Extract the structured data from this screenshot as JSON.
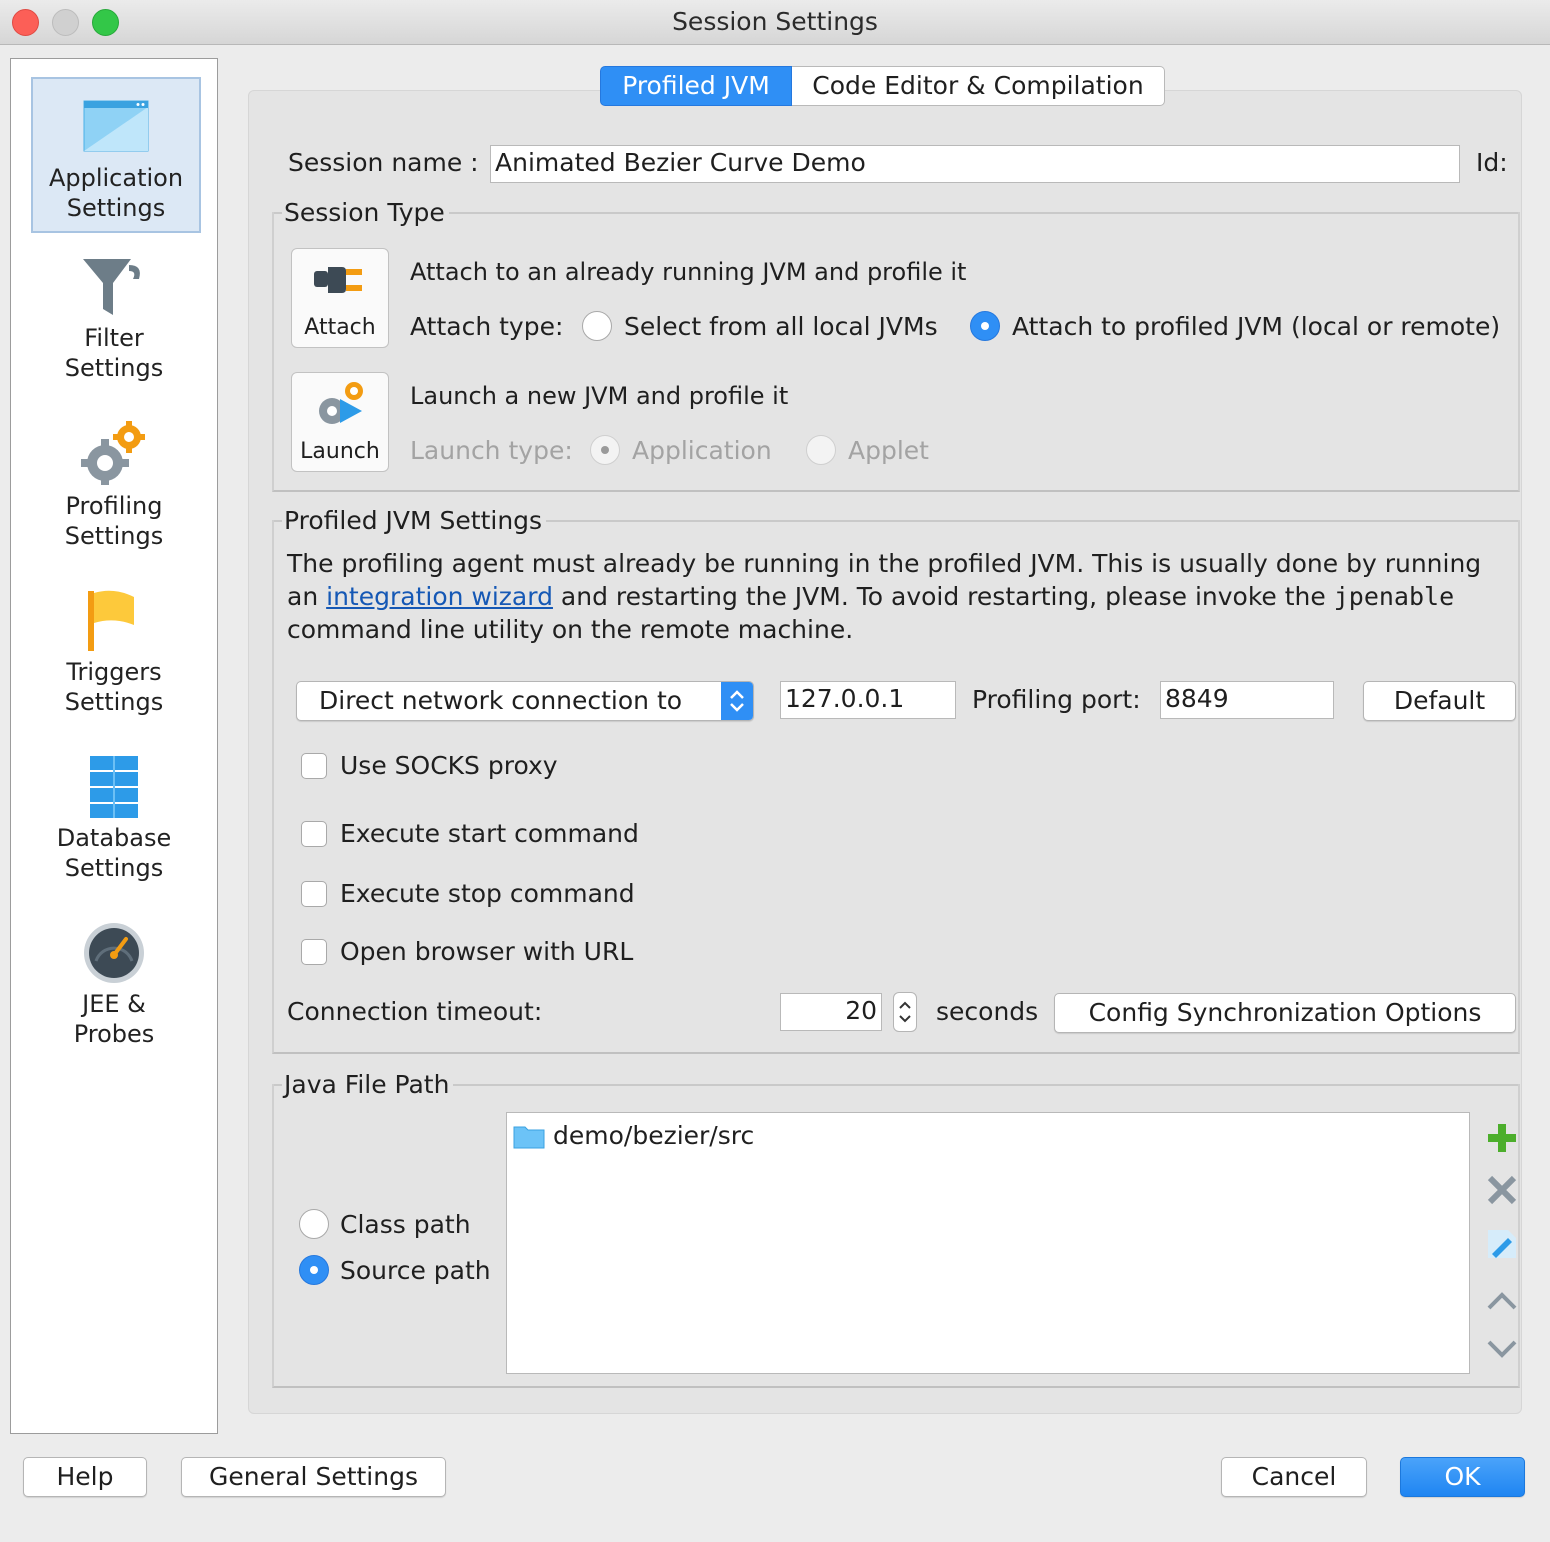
{
  "window": {
    "title": "Session Settings"
  },
  "sidebar": {
    "items": [
      {
        "line1": "Application",
        "line2": "Settings",
        "icon": "application-window-icon",
        "selected": true
      },
      {
        "line1": "Filter",
        "line2": "Settings",
        "icon": "funnel-icon"
      },
      {
        "line1": "Profiling",
        "line2": "Settings",
        "icon": "gears-icon"
      },
      {
        "line1": "Triggers",
        "line2": "Settings",
        "icon": "flag-icon"
      },
      {
        "line1": "Database",
        "line2": "Settings",
        "icon": "database-icon"
      },
      {
        "line1": "JEE &",
        "line2": "Probes",
        "icon": "gauge-icon"
      }
    ]
  },
  "tabs": [
    {
      "label": "Profiled JVM",
      "active": true
    },
    {
      "label": "Code Editor & Compilation",
      "active": false
    }
  ],
  "session": {
    "name_label": "Session name :",
    "name_value": "Animated Bezier Curve Demo",
    "id_label": "Id:"
  },
  "session_type": {
    "title": "Session Type",
    "attach": {
      "button_label": "Attach",
      "description": "Attach to an already running JVM and profile it",
      "type_label": "Attach type:",
      "options": [
        {
          "label": "Select from all local JVMs",
          "selected": false
        },
        {
          "label": "Attach to profiled JVM (local or remote)",
          "selected": true
        }
      ]
    },
    "launch": {
      "button_label": "Launch",
      "description": "Launch a new JVM and profile it",
      "type_label": "Launch type:",
      "options": [
        {
          "label": "Application",
          "selected": true
        },
        {
          "label": "Applet",
          "selected": false
        }
      ]
    }
  },
  "profiled_jvm": {
    "title": "Profiled JVM Settings",
    "info_before_link": "The profiling agent must already be running in the profiled JVM. This is usually done by running",
    "info_an": "an",
    "link_text": "integration wizard",
    "info_after_link": "and restarting the JVM. To avoid restarting, please invoke the",
    "info_code": "jpenable",
    "info_line3": "command line utility on the remote machine.",
    "connection_type": "Direct network connection to",
    "host": "127.0.0.1",
    "port_label": "Profiling port:",
    "port": "8849",
    "default_button": "Default",
    "checkboxes": [
      {
        "label": "Use SOCKS proxy",
        "checked": false
      },
      {
        "label": "Execute start command",
        "checked": false
      },
      {
        "label": "Execute stop command",
        "checked": false
      },
      {
        "label": "Open browser with URL",
        "checked": false
      }
    ],
    "timeout_label": "Connection timeout:",
    "timeout_value": "20",
    "timeout_unit": "seconds",
    "config_sync_button": "Config Synchronization Options"
  },
  "java_file_path": {
    "title": "Java File Path",
    "options": [
      {
        "label": "Class path",
        "selected": false
      },
      {
        "label": "Source path",
        "selected": true
      }
    ],
    "entries": [
      "demo/bezier/src"
    ],
    "actions": [
      "add-icon",
      "remove-icon",
      "edit-icon",
      "move-up-icon",
      "move-down-icon"
    ]
  },
  "footer": {
    "help": "Help",
    "general_settings": "General Settings",
    "cancel": "Cancel",
    "ok": "OK"
  },
  "colors": {
    "accent": "#2f8ff5",
    "link": "#1558b5",
    "add_green": "#4cae2c"
  }
}
